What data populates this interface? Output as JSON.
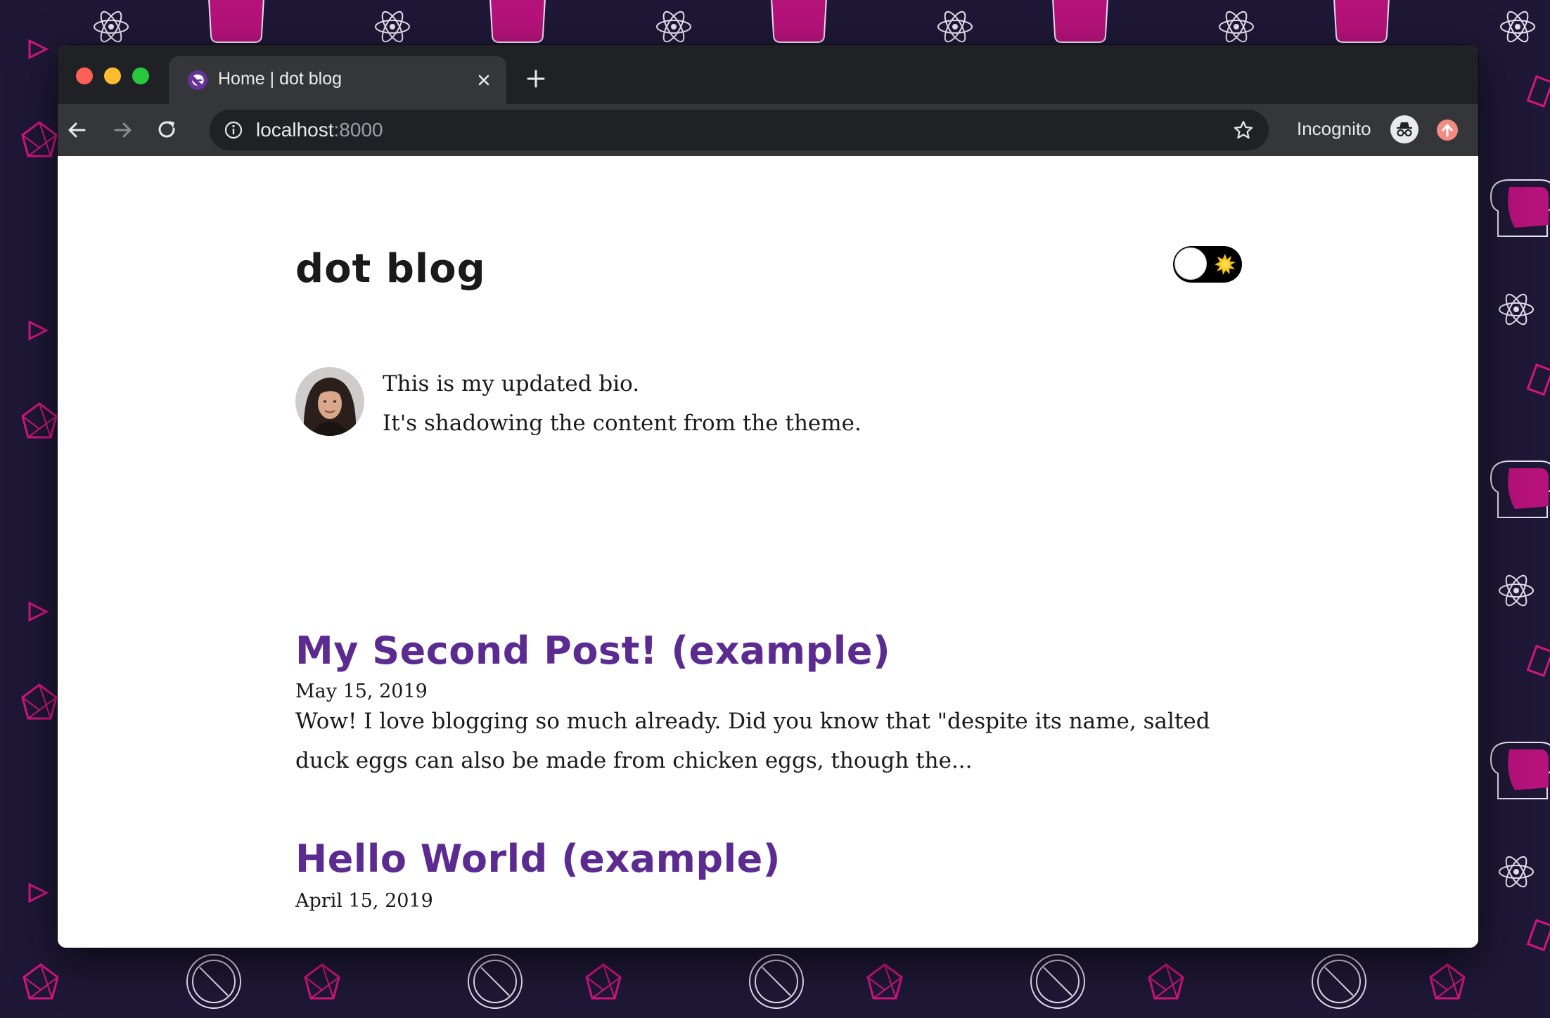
{
  "browser": {
    "tab_title": "Home | dot blog",
    "url_host": "localhost",
    "url_port": ":8000",
    "profile_label": "Incognito",
    "icons": {
      "close": "close-icon",
      "new_tab": "plus-icon",
      "back": "arrow-left-icon",
      "forward": "arrow-right-icon",
      "reload": "reload-icon",
      "info": "info-icon",
      "bookmark": "star-icon",
      "profile": "incognito-icon",
      "update": "update-arrow-icon"
    }
  },
  "site": {
    "title": "dot blog",
    "theme_toggle_icon": "sun-icon",
    "bio": {
      "line1": "This is my updated bio.",
      "line2": "It's shadowing the content from the theme."
    }
  },
  "posts": [
    {
      "title": "My Second Post! (example)",
      "date": "May 15, 2019",
      "excerpt": "Wow! I love blogging so much already. Did you know that \"despite its name, salted duck eggs can also be made from chicken eggs, though the..."
    },
    {
      "title": "Hello World (example)",
      "date": "April 15, 2019"
    }
  ],
  "colors": {
    "background": "#1e1836",
    "accent": "#5b2b91",
    "pattern_magenta": "#b5127a",
    "browser_dark": "#202124",
    "browser_toolbar": "#35363a"
  }
}
